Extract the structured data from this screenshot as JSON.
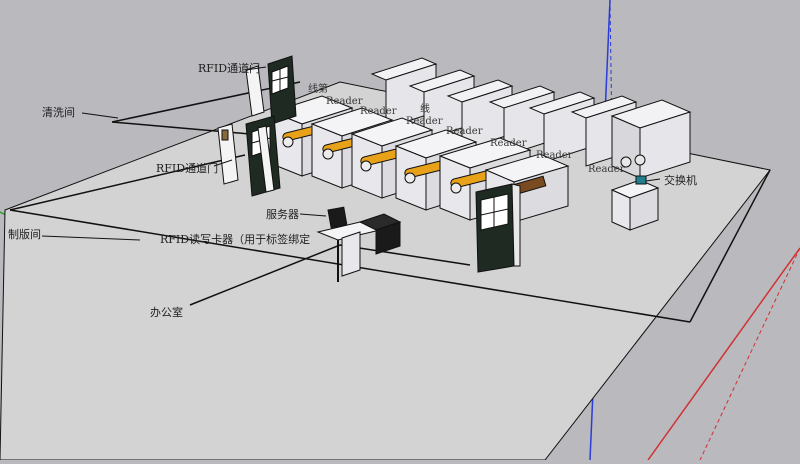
{
  "labels": {
    "cleaning_room": "清洗间",
    "plate_room": "制版间",
    "office": "办公室",
    "rfid_gate_top": "RFID通道门",
    "rfid_gate_mid": "RFID通道门",
    "server": "服务器",
    "rfid_reader_writer": "RFID读写卡器（用于标签绑定",
    "switch": "交换机",
    "line_text_a": "线第",
    "line_text_b": "线",
    "reader_a": "Reader",
    "reader_b": "Reader",
    "reader_c": "Reader",
    "reader_d": "Reader",
    "reader_e": "Reader",
    "reader_f": "Reader",
    "reader_g": "Reader"
  },
  "colors": {
    "background": "#b9b9be",
    "floor": "#d2d2d2",
    "machine_body": "#ececf0",
    "roller_orange": "#e7a21a",
    "door_dark": "#1f2a22",
    "axis_green": "#2aa02a",
    "axis_blue": "#2a3bd8",
    "axis_red": "#d13030"
  }
}
